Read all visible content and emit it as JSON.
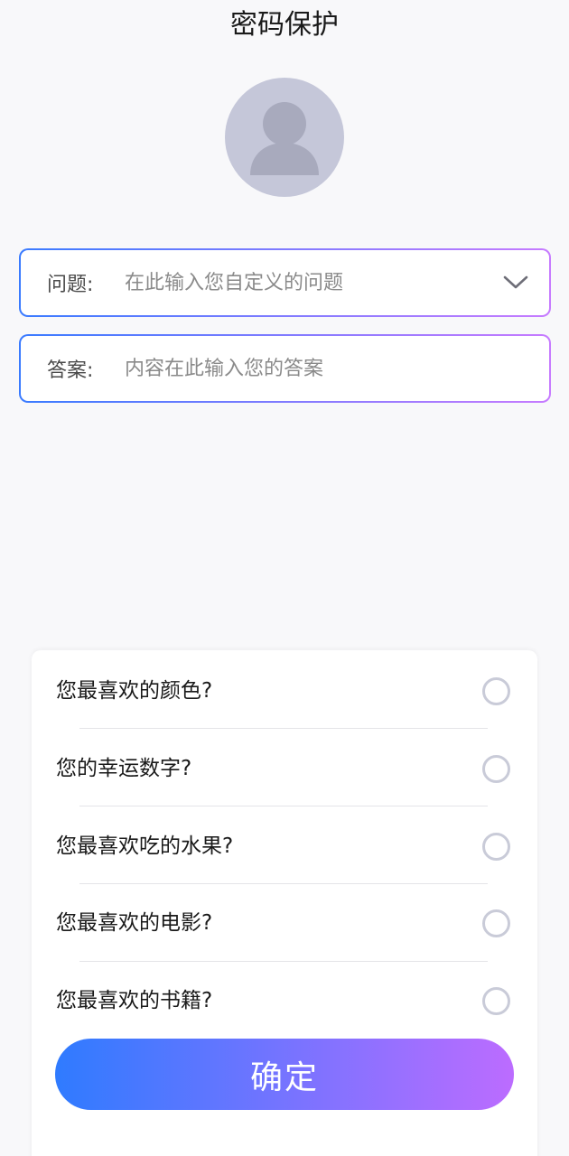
{
  "header": {
    "title": "密码保护"
  },
  "avatar": {
    "icon": "user-avatar-icon",
    "bg_color": "#c5c7d9",
    "fg_color": "#a8aabd"
  },
  "question_field": {
    "label": "问题:",
    "placeholder": "在此输入您自定义的问题",
    "value": "",
    "dropdown_icon": "chevron-down-icon"
  },
  "answer_field": {
    "label": "答案:",
    "placeholder": "内容在此输入您的答案",
    "value": ""
  },
  "question_sheet": {
    "options": [
      {
        "label": "您最喜欢的颜色?",
        "selected": false
      },
      {
        "label": "您的幸运数字?",
        "selected": false
      },
      {
        "label": "您最喜欢吃的水果?",
        "selected": false
      },
      {
        "label": "您最喜欢的电影?",
        "selected": false
      },
      {
        "label": "您最喜欢的书籍?",
        "selected": false
      }
    ],
    "confirm_label": "确定"
  },
  "colors": {
    "gradient_start": "#2f7bff",
    "gradient_end": "#bc6cff",
    "radio_border": "#c9cbd8",
    "page_bg": "#f8f8fa"
  }
}
